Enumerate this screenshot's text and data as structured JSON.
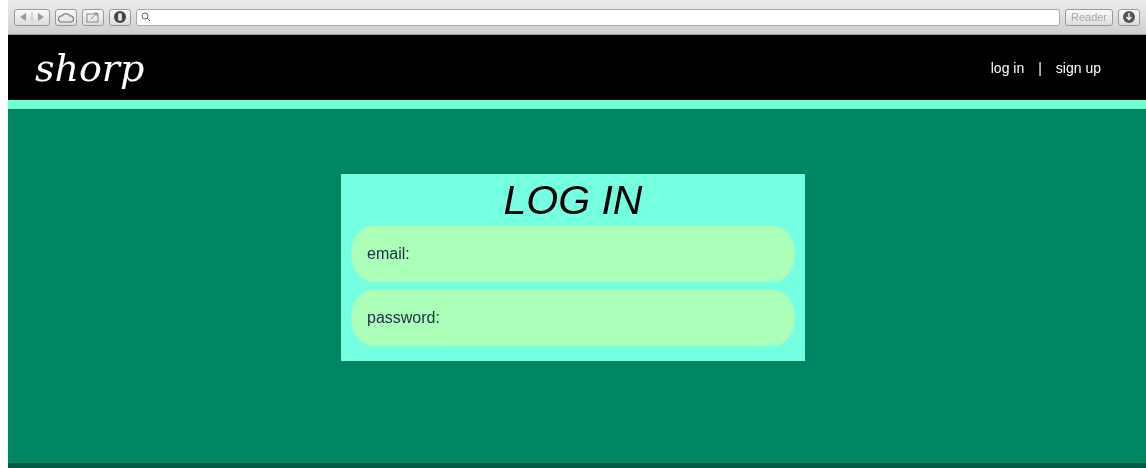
{
  "browser": {
    "reader_button": "Reader"
  },
  "header": {
    "logo": "shorp",
    "nav": [
      {
        "label": "log in"
      },
      {
        "label": "sign up"
      }
    ],
    "separator": "|"
  },
  "login_card": {
    "title": "LOG IN",
    "fields": [
      {
        "placeholder": "email:"
      },
      {
        "placeholder": "password:"
      }
    ]
  }
}
